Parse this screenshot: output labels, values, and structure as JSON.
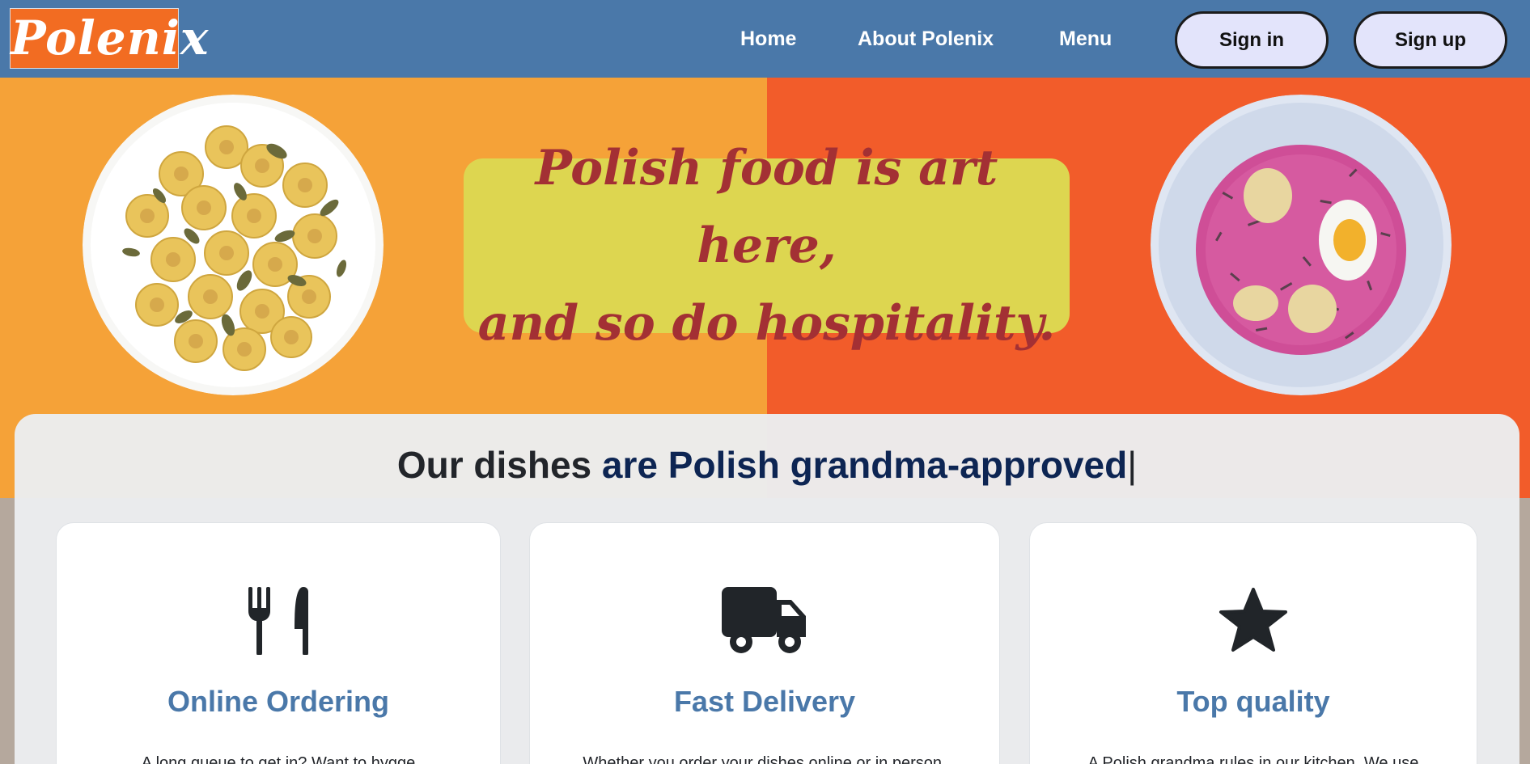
{
  "nav": {
    "logo": "Polenix",
    "links": [
      "Home",
      "About Polenix",
      "Menu"
    ],
    "sign_in": "Sign in",
    "sign_up": "Sign up"
  },
  "hero": {
    "tagline_line1": "Polish food is art here,",
    "tagline_line2": "and so do hospitality."
  },
  "features": {
    "heading_plain": "Our dishes ",
    "heading_bold": "are Polish grandma-approved",
    "heading_cursor": "|",
    "cards": [
      {
        "icon": "utensils-icon",
        "title": "Online Ordering",
        "text": "A long queue to get in? Want to hygge"
      },
      {
        "icon": "truck-icon",
        "title": "Fast Delivery",
        "text": "Whether you order your dishes online or in person,"
      },
      {
        "icon": "star-icon",
        "title": "Top quality",
        "text": "A Polish grandma rules in our kitchen. We use"
      }
    ]
  },
  "colors": {
    "navbar": "#4a78a9",
    "logo_bg": "#f26c22",
    "hero_left": "#f5a238",
    "hero_right": "#f25c2a",
    "tagline_bg": "#ddd650",
    "tagline_text": "#a33034",
    "accent_text": "#4a78a9",
    "heading_bold": "#0d2553"
  }
}
